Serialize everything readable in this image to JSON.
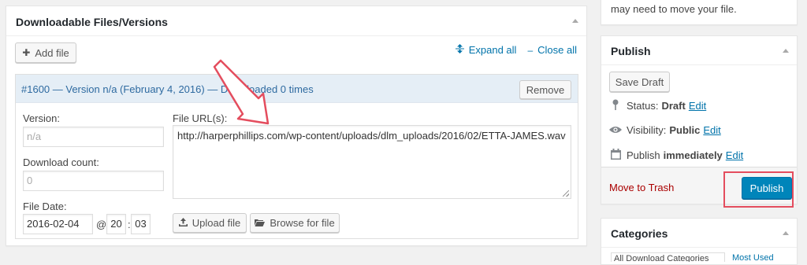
{
  "downloads_panel": {
    "title": "Downloadable Files/Versions",
    "add_file_label": "Add file",
    "expand_all_label": "Expand all",
    "close_all_label": "Close all",
    "version": {
      "header": "#1600 — Version n/a (February 4, 2016) — Downloaded 0 times",
      "remove_label": "Remove",
      "version_label": "Version:",
      "version_placeholder": "n/a",
      "download_count_label": "Download count:",
      "download_count_placeholder": "0",
      "file_date_label": "File Date:",
      "file_date_value": "2016-02-04",
      "at_sign": "@",
      "hour_value": "20",
      "minute_value": "03",
      "file_urls_label": "File URL(s):",
      "file_url_value": "http://harperphillips.com/wp-content/uploads/dlm_uploads/2016/02/ETTA-JAMES.wav",
      "upload_file_label": "Upload file",
      "browse_file_label": "Browse for file"
    }
  },
  "sidebar": {
    "top_fragment_text": "may need to move your file.",
    "publish": {
      "title": "Publish",
      "save_draft_label": "Save Draft",
      "status_label": "Status:",
      "status_value": "Draft",
      "status_edit": "Edit",
      "visibility_label": "Visibility:",
      "visibility_value": "Public",
      "visibility_edit": "Edit",
      "publish_label": "Publish",
      "publish_value": "immediately",
      "publish_edit": "Edit",
      "move_to_trash_label": "Move to Trash",
      "publish_button_label": "Publish"
    },
    "categories": {
      "title": "Categories",
      "tab_all": "All Download Categories",
      "tab_most_used": "Most Used"
    }
  },
  "colors": {
    "accent_link": "#0073aa",
    "publish_button": "#0085ba",
    "annotation_red": "#e44d5e",
    "trash_red": "#a00",
    "version_header_bg": "#e5eef6"
  },
  "icons": {
    "add": "plus-icon",
    "expand": "expand-icon",
    "close": "minus-icon",
    "upload": "upload-icon",
    "browse": "folder-icon",
    "status": "pin-icon",
    "visibility": "eye-icon",
    "publish_date": "calendar-icon",
    "annotation": "arrow-annotation"
  }
}
